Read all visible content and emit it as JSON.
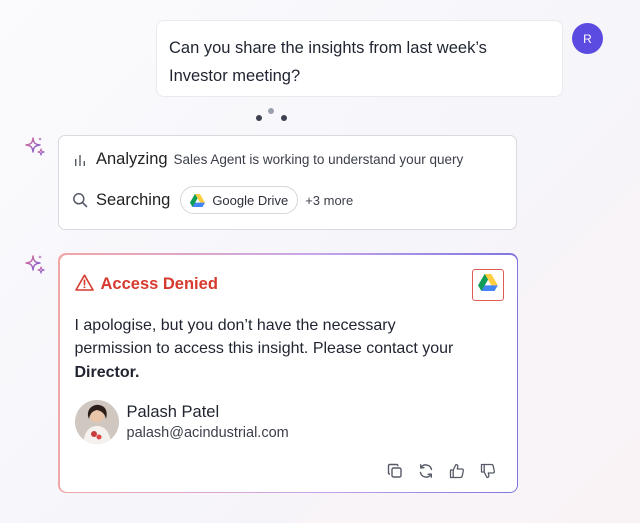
{
  "user_message": {
    "text": "Can you share the insights from last week’s Investor meeting?",
    "avatar_initial": "R",
    "avatar_color": "#5b4be0"
  },
  "status": {
    "analyzing": {
      "title": "Analyzing",
      "description": "Sales Agent is working to understand your query",
      "icon": "bar-chart-icon"
    },
    "searching": {
      "title": "Searching",
      "icon": "search-icon",
      "source_chip": "Google Drive",
      "more_label": "+3 more"
    }
  },
  "access_denied": {
    "title": "Access Denied",
    "title_color": "#d63a2e",
    "message_prefix": "I apologise, but you don’t have the necessary permission to access this insight. Please contact your ",
    "message_bold": "Director.",
    "contact": {
      "name": "Palash Patel",
      "email": "palash@acindustrial.com"
    },
    "actions": [
      "copy-icon",
      "regenerate-icon",
      "thumbs-up-icon",
      "thumbs-down-icon"
    ]
  }
}
